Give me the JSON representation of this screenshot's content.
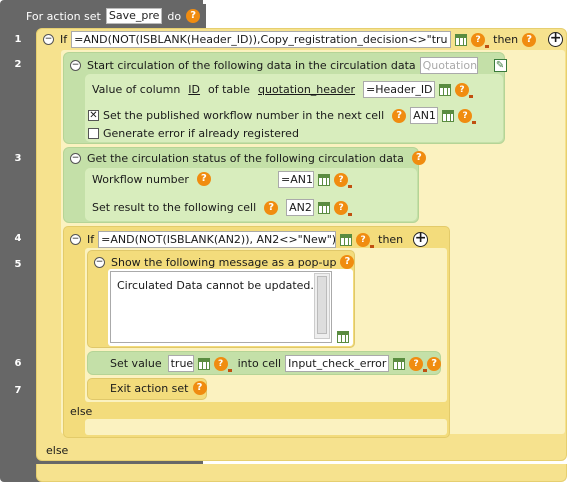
{
  "header": {
    "prefix": "For action set",
    "set_name": "Save_pre",
    "suffix": "do"
  },
  "line_numbers": [
    "1",
    "2",
    "3",
    "4",
    "5",
    "6",
    "7"
  ],
  "if1": {
    "keyword": "If",
    "condition": "=AND(NOT(ISBLANK(Header_ID)),Copy_registration_decision<>\"tru",
    "then": "then",
    "else": "else"
  },
  "circ": {
    "title": "Start circulation of the following data in the circulation data",
    "placeholder": "Quotation",
    "value_of_col": "Value of column",
    "col": "ID",
    "of_table": "of table",
    "table": "quotation_header",
    "value": "=Header_ID",
    "set_published": "Set the published workflow number in the next cell",
    "published_cell": "AN1",
    "error_label": "Generate error if already registered"
  },
  "status": {
    "title": "Get the circulation status of the following circulation data",
    "wf_label": "Workflow number",
    "wf_value": "=AN1",
    "result_label": "Set result to the following cell",
    "result_value": "AN2"
  },
  "if2": {
    "keyword": "If",
    "condition": "=AND(NOT(ISBLANK(AN2)), AN2<>\"New\")",
    "then": "then",
    "else": "else"
  },
  "popup": {
    "title": "Show the following message as a pop-up",
    "message": "Circulated Data cannot be updated."
  },
  "setval": {
    "label": "Set value",
    "value": "true",
    "into": "into cell",
    "cell": "Input_check_error"
  },
  "exit": {
    "label": "Exit action set"
  },
  "colors": {
    "gutter": "#676767",
    "yellow": "#f5e08a",
    "green": "#c4e0a8",
    "question": "#f08c10"
  },
  "icons": {
    "help": "help-icon",
    "grid": "cell-reference-icon",
    "formula": "formula-help-icon",
    "add": "add-icon",
    "collapse": "collapse-icon"
  }
}
